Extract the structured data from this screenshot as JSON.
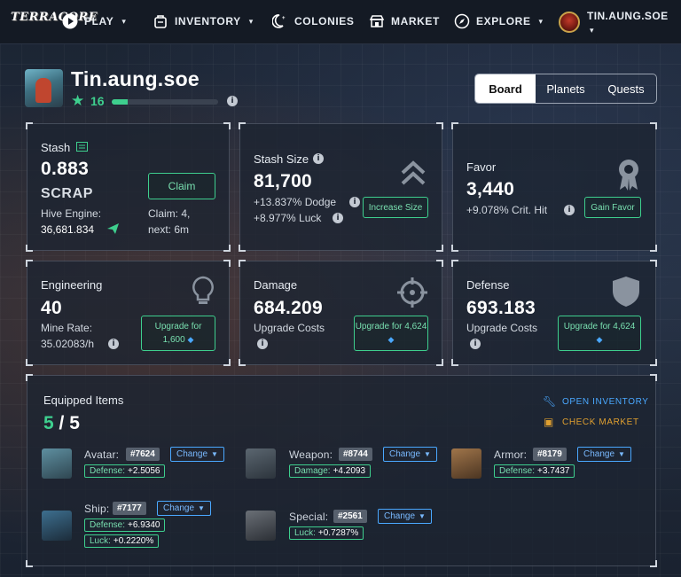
{
  "nav": {
    "logo": "TERRACORE",
    "play": "PLAY",
    "inventory": "INVENTORY",
    "colonies": "COLONIES",
    "market": "MARKET",
    "explore": "EXPLORE",
    "username": "TIN.AUNG.SOE",
    "caret": "▾"
  },
  "profile": {
    "name": "Tin.aung.soe",
    "level": "16",
    "xp_progress": 0.15
  },
  "tabs": [
    "Board",
    "Planets",
    "Quests"
  ],
  "stash": {
    "title": "Stash",
    "value": "0.883",
    "unit": "SCRAP",
    "claim_label": "Claim",
    "hive_label": "Hive Engine:",
    "hive_value": "36,681.834",
    "claim_info": "Claim: 4,",
    "next_info": "next: 6m"
  },
  "stash_size": {
    "title": "Stash Size",
    "value": "81,700",
    "dodge": "+13.837% Dodge",
    "luck": "+8.977% Luck",
    "button": "Increase Size"
  },
  "favor": {
    "title": "Favor",
    "value": "3,440",
    "crit": "+9.078% Crit. Hit",
    "button": "Gain Favor"
  },
  "engineering": {
    "title": "Engineering",
    "value": "40",
    "rate_label": "Mine Rate:",
    "rate_value": "35.02083/h",
    "button_line1": "Upgrade for",
    "button_line2": "1,600"
  },
  "damage": {
    "title": "Damage",
    "value": "684.209",
    "costs_label": "Upgrade Costs",
    "button_line1": "Upgrade for 4,624"
  },
  "defense": {
    "title": "Defense",
    "value": "693.183",
    "costs_label": "Upgrade Costs",
    "button_line1": "Upgrade for 4,624"
  },
  "equipped": {
    "title": "Equipped Items",
    "current": "5",
    "separator": " / ",
    "total": "5",
    "open_inventory": "OPEN INVENTORY",
    "check_market": "CHECK MARKET",
    "change_label": "Change",
    "avatar": {
      "label": "Avatar:",
      "id": "#7624",
      "stats": [
        {
          "k": "Defense:",
          "v": "+2.5056"
        }
      ]
    },
    "weapon": {
      "label": "Weapon:",
      "id": "#8744",
      "stats": [
        {
          "k": "Damage:",
          "v": "+4.2093"
        }
      ]
    },
    "armor": {
      "label": "Armor:",
      "id": "#8179",
      "stats": [
        {
          "k": "Defense:",
          "v": "+3.7437"
        }
      ]
    },
    "ship": {
      "label": "Ship:",
      "id": "#7177",
      "stats": [
        {
          "k": "Defense:",
          "v": "+6.9340"
        },
        {
          "k": "Luck:",
          "v": "+0.2220%"
        }
      ]
    },
    "special": {
      "label": "Special:",
      "id": "#2561",
      "stats": [
        {
          "k": "Luck:",
          "v": "+0.7287%"
        }
      ]
    }
  },
  "colors": {
    "accent_green": "#3ecf8e",
    "accent_blue": "#4aa8ff",
    "accent_gold": "#e0a030",
    "card_bg": "#1c2431"
  }
}
